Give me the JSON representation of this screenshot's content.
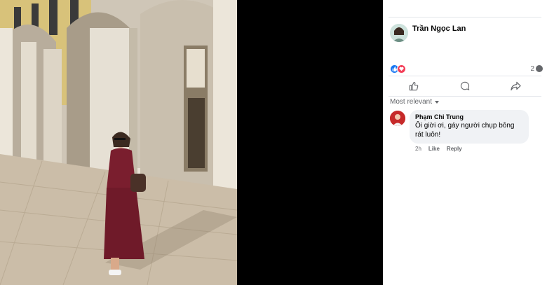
{
  "post": {
    "author_name": "Trần Ngọc Lan",
    "comment_count": "2"
  },
  "comments": {
    "sort_label": "Most relevant",
    "items": [
      {
        "name": "Phạm Chi Trung",
        "text": "Ôi giời ơi, gáy người chụp bông rát luôn!",
        "time": "2h",
        "like_label": "Like",
        "reply_label": "Reply"
      }
    ]
  },
  "icons": {
    "like": "like-icon",
    "comment": "comment-icon",
    "share": "share-icon",
    "like_reaction": "thumbs-up-reaction-icon",
    "love_reaction": "heart-reaction-icon"
  },
  "colors": {
    "fb_blue": "#1877f2",
    "love_red": "#f33e58",
    "secondary_text": "#65676b",
    "comment_bubble": "#f0f2f5"
  }
}
